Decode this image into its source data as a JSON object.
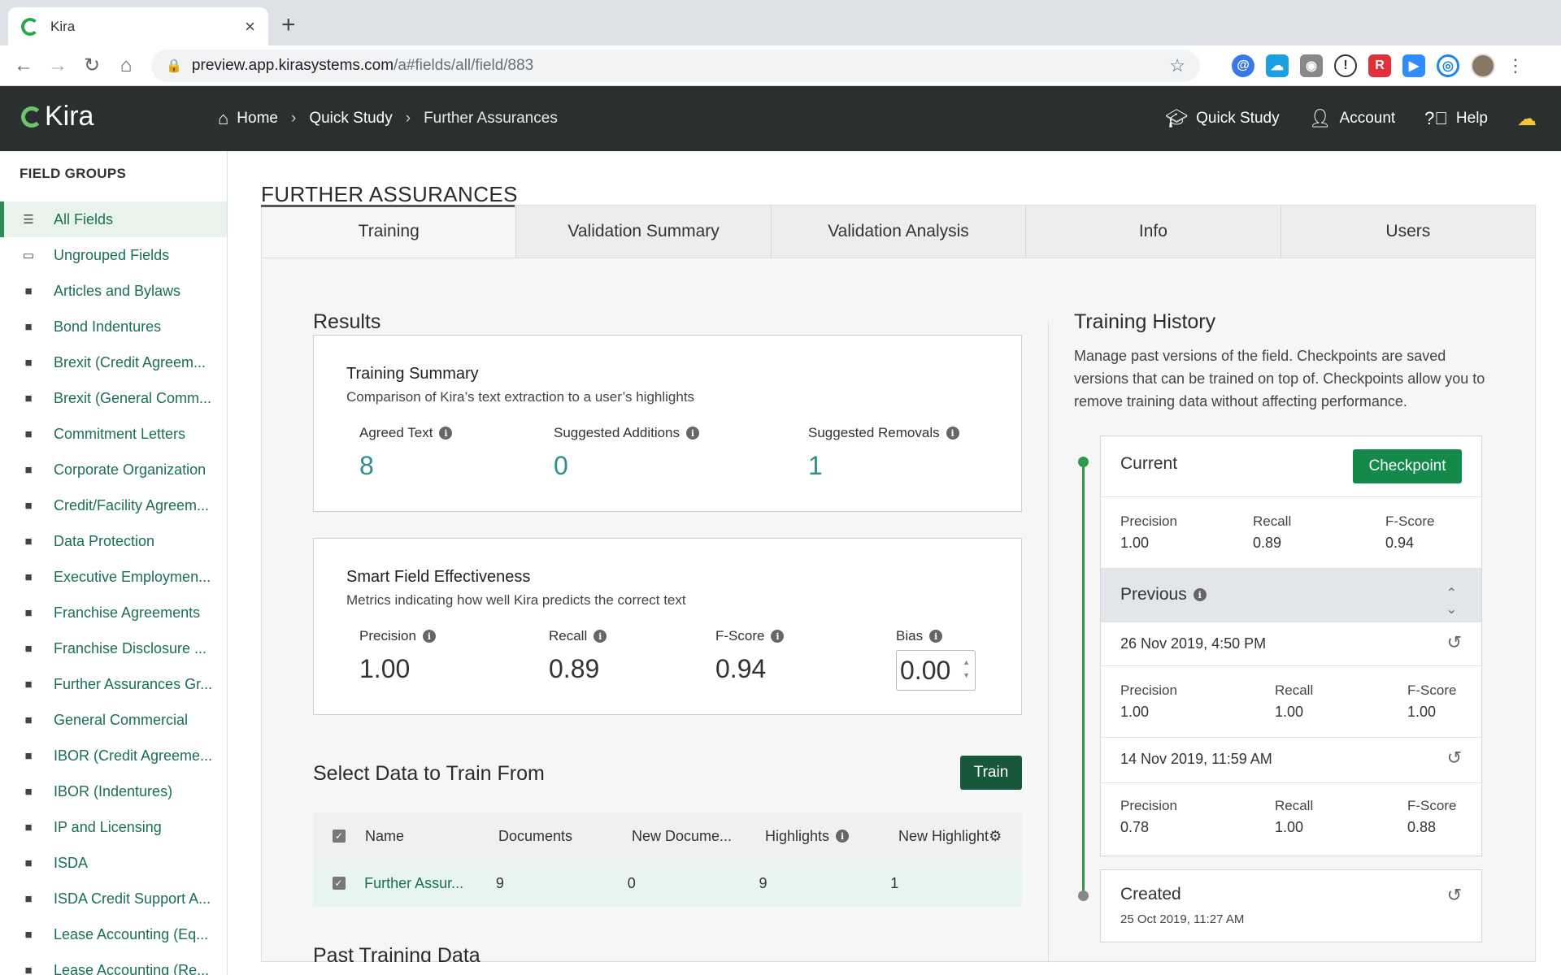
{
  "browser": {
    "tab_title": "Kira",
    "url_host": "preview.app.kirasystems.com",
    "url_path": "/a#fields/all/field/883"
  },
  "header": {
    "logo": "Kira",
    "breadcrumbs": [
      "Home",
      "Quick Study",
      "Further Assurances"
    ],
    "nav": [
      "Quick Study",
      "Account",
      "Help"
    ]
  },
  "sidebar": {
    "heading": "FIELD GROUPS",
    "items": [
      {
        "label": "All Fields"
      },
      {
        "label": "Ungrouped Fields"
      },
      {
        "label": "Articles and Bylaws"
      },
      {
        "label": "Bond Indentures"
      },
      {
        "label": "Brexit (Credit Agreem..."
      },
      {
        "label": "Brexit (General Comm..."
      },
      {
        "label": "Commitment Letters"
      },
      {
        "label": "Corporate Organization"
      },
      {
        "label": "Credit/Facility Agreem..."
      },
      {
        "label": "Data Protection"
      },
      {
        "label": "Executive Employmen..."
      },
      {
        "label": "Franchise Agreements"
      },
      {
        "label": "Franchise Disclosure ..."
      },
      {
        "label": "Further Assurances Gr..."
      },
      {
        "label": "General Commercial"
      },
      {
        "label": "IBOR (Credit Agreeme..."
      },
      {
        "label": "IBOR (Indentures)"
      },
      {
        "label": "IP and Licensing"
      },
      {
        "label": "ISDA"
      },
      {
        "label": "ISDA Credit Support A..."
      },
      {
        "label": "Lease Accounting (Eq..."
      },
      {
        "label": "Lease Accounting (Re..."
      }
    ]
  },
  "main": {
    "title": "FURTHER ASSURANCES",
    "tabs": [
      "Training",
      "Validation Summary",
      "Validation Analysis",
      "Info",
      "Users"
    ],
    "results_heading": "Results",
    "training_summary": {
      "title": "Training Summary",
      "subtitle": "Comparison of Kira’s text extraction to a user’s highlights",
      "metrics": [
        {
          "label": "Agreed Text",
          "value": "8"
        },
        {
          "label": "Suggested Additions",
          "value": "0"
        },
        {
          "label": "Suggested Removals",
          "value": "1"
        }
      ]
    },
    "smart_field": {
      "title": "Smart Field Effectiveness",
      "subtitle": "Metrics indicating how well Kira predicts the correct text",
      "metrics": [
        {
          "label": "Precision",
          "value": "1.00"
        },
        {
          "label": "Recall",
          "value": "0.89"
        },
        {
          "label": "F-Score",
          "value": "0.94"
        },
        {
          "label": "Bias",
          "value": "0.00"
        }
      ]
    },
    "select_data": {
      "heading": "Select Data to Train From",
      "train_button": "Train",
      "columns": [
        "Name",
        "Documents",
        "New Docume...",
        "Highlights",
        "New Highlight"
      ],
      "rows": [
        {
          "name": "Further Assur...",
          "documents": "9",
          "new_documents": "0",
          "highlights": "9",
          "new_highlights": "1"
        }
      ]
    },
    "past_training_heading": "Past Training Data",
    "history": {
      "heading": "Training History",
      "description": "Manage past versions of the field. Checkpoints are saved versions that can be trained on top of. Checkpoints allow you to remove training data without affecting performance.",
      "current_label": "Current",
      "checkpoint_button": "Checkpoint",
      "metric_labels": [
        "Precision",
        "Recall",
        "F-Score"
      ],
      "current_values": [
        "1.00",
        "0.89",
        "0.94"
      ],
      "previous_label": "Previous",
      "previous": [
        {
          "date": "26 Nov 2019, 4:50 PM",
          "values": [
            "1.00",
            "1.00",
            "1.00"
          ]
        },
        {
          "date": "14 Nov 2019, 11:59 AM",
          "values": [
            "0.78",
            "1.00",
            "0.88"
          ]
        }
      ],
      "created_label": "Created",
      "created_date": "25 Oct 2019, 11:27 AM"
    }
  }
}
